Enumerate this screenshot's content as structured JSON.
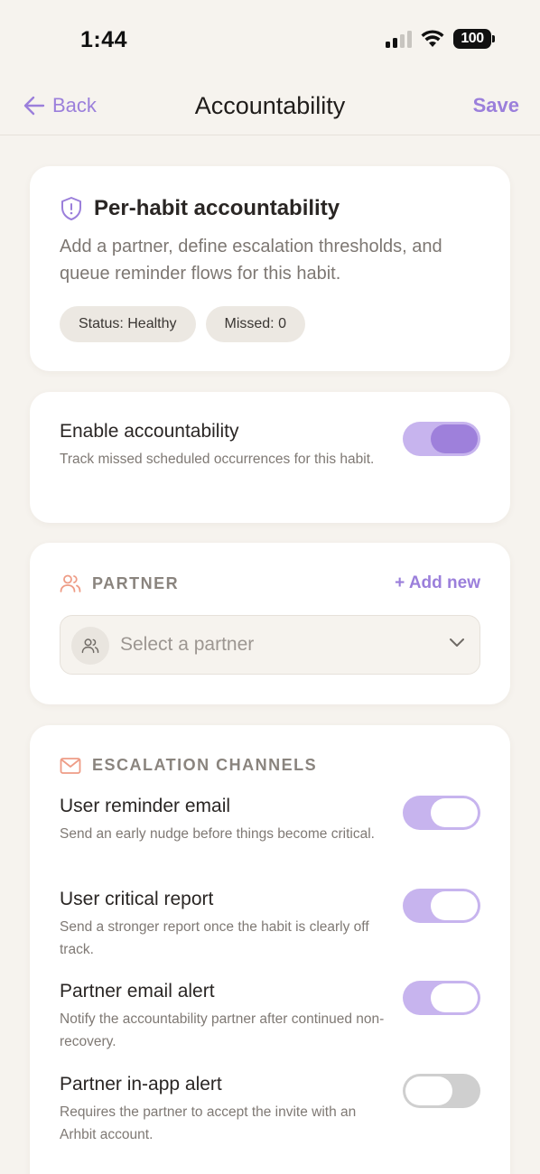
{
  "status_bar": {
    "time": "1:44",
    "battery": "100"
  },
  "nav": {
    "back_label": "Back",
    "title": "Accountability",
    "save_label": "Save"
  },
  "summary": {
    "title": "Per-habit accountability",
    "description": "Add a partner, define escalation thresholds, and queue reminder flows for this habit.",
    "chips": [
      "Status: Healthy",
      "Missed: 0"
    ]
  },
  "enable": {
    "title": "Enable accountability",
    "description": "Track missed scheduled occurrences for this habit.",
    "on": true
  },
  "partner": {
    "section_label": "PARTNER",
    "add_new_label": "+ Add new",
    "select_placeholder": "Select a partner"
  },
  "escalation": {
    "section_label": "ESCALATION CHANNELS",
    "channels": [
      {
        "title": "User reminder email",
        "description": "Send an early nudge before things become critical.",
        "on": true
      },
      {
        "title": "User critical report",
        "description": "Send a stronger report once the habit is clearly off track.",
        "on": true
      },
      {
        "title": "Partner email alert",
        "description": "Notify the accountability partner after continued non-recovery.",
        "on": true
      },
      {
        "title": "Partner in-app alert",
        "description": "Requires the partner to accept the invite with an Arhbit account.",
        "on": false
      }
    ]
  },
  "colors": {
    "accent": "#9B7FDB",
    "toggle_on": "#C7B4EE",
    "toggle_off": "#CFCFCF",
    "icon_coral": "#EE9C86",
    "background": "#F6F3EE"
  }
}
